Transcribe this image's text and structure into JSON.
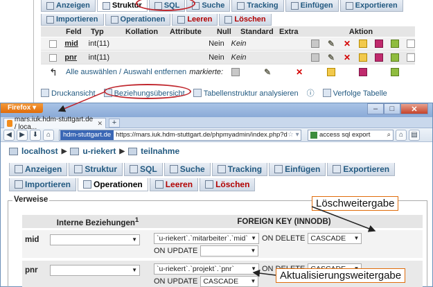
{
  "background": {
    "tabs_row1": [
      {
        "label": "Anzeigen"
      },
      {
        "label": "Struktur"
      },
      {
        "label": "SQL"
      },
      {
        "label": "Suche"
      },
      {
        "label": "Tracking"
      },
      {
        "label": "Einfügen"
      },
      {
        "label": "Exportieren"
      }
    ],
    "tabs_row2": [
      {
        "label": "Importieren"
      },
      {
        "label": "Operationen"
      },
      {
        "label": "Leeren"
      },
      {
        "label": "Löschen"
      }
    ],
    "table": {
      "headers": [
        "Feld",
        "Typ",
        "Kollation",
        "Attribute",
        "Null",
        "Standard",
        "Extra",
        "Aktion"
      ],
      "rows": [
        {
          "feld": "mid",
          "typ": "int(11)",
          "null": "Nein",
          "standard": "Kein"
        },
        {
          "feld": "pnr",
          "typ": "int(11)",
          "null": "Nein",
          "standard": "Kein"
        }
      ]
    },
    "select_all": "Alle auswählen",
    "separator": "/",
    "deselect_all": "Auswahl entfernen",
    "marked": "markierte:",
    "links": {
      "print": "Druckansicht",
      "relations": "Beziehungsübersicht",
      "analyze": "Tabellenstruktur analysieren",
      "track": "Verfolge Tabelle"
    }
  },
  "firefox": {
    "menu_button": "Firefox",
    "tab_title": "mars.iuk.hdm-stuttgart.de / loca...",
    "url_site": "hdm-stuttgart.de",
    "url": "https://mars.iuk.hdm-stuttgart.de/phpmyadmin/index.php?d",
    "search_text": "access sql export",
    "breadcrumb": {
      "server": "localhost",
      "db": "u-riekert",
      "table": "teilnahme"
    },
    "tabs_row1": [
      {
        "label": "Anzeigen"
      },
      {
        "label": "Struktur"
      },
      {
        "label": "SQL"
      },
      {
        "label": "Suche"
      },
      {
        "label": "Tracking"
      },
      {
        "label": "Einfügen"
      },
      {
        "label": "Exportieren"
      }
    ],
    "tabs_row2": [
      {
        "label": "Importieren"
      },
      {
        "label": "Operationen"
      },
      {
        "label": "Leeren"
      },
      {
        "label": "Löschen"
      }
    ],
    "fieldset_legend": "Verweise",
    "col_internal": "Interne Beziehungen",
    "col_internal_sup": "1",
    "col_foreign": "FOREIGN KEY (INNODB)",
    "rows": [
      {
        "label": "mid",
        "fk_target": "`u-riekert`.`mitarbeiter`.`mid`",
        "on_delete_label": "ON DELETE",
        "on_delete": "CASCADE",
        "on_update_label": "ON UPDATE",
        "on_update": ""
      },
      {
        "label": "pnr",
        "fk_target": "`u-riekert`.`projekt`.`pnr`",
        "on_delete_label": "ON DELETE",
        "on_delete": "CASCADE",
        "on_update_label": "ON UPDATE",
        "on_update": "CASCADE"
      }
    ]
  },
  "annotations": {
    "delete_propagation": "Löschweitergabe",
    "update_propagation": "Aktualisierungsweitergabe"
  }
}
